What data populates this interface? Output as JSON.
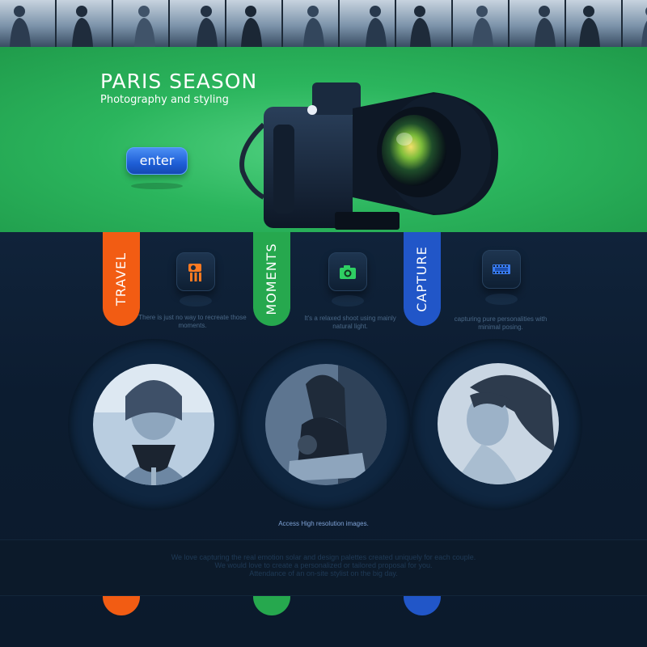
{
  "thumbnails": [
    {
      "name": "thumb-1"
    },
    {
      "name": "thumb-2"
    },
    {
      "name": "thumb-3"
    },
    {
      "name": "thumb-4"
    },
    {
      "name": "thumb-5"
    },
    {
      "name": "thumb-6"
    },
    {
      "name": "thumb-7"
    },
    {
      "name": "thumb-8"
    },
    {
      "name": "thumb-9"
    },
    {
      "name": "thumb-10"
    },
    {
      "name": "thumb-11"
    },
    {
      "name": "thumb-12"
    }
  ],
  "hero": {
    "title": "PARIS SEASON",
    "subtitle": "Photography and styling",
    "enter_label": "enter",
    "background_color": "#2bb55d"
  },
  "features": [
    {
      "label": "TRAVEL",
      "color": "#f25c13",
      "icon": "camera-tripod-icon",
      "icon_color": "#ff7a22",
      "text": "There is just no way to recreate those moments."
    },
    {
      "label": "MOMENTS",
      "color": "#26a84e",
      "icon": "camera-icon",
      "icon_color": "#2fcf63",
      "text": "It's a relaxed shoot using mainly natural light."
    },
    {
      "label": "CAPTURE",
      "color": "#2156c8",
      "icon": "film-strip-icon",
      "icon_color": "#3a7cf0",
      "text": "capturing pure personalities with minimal posing."
    }
  ],
  "access_text": "Access High resolution images.",
  "band_lines": [
    "We love capturing the real emotion solar and design palettes created uniquely for each couple.",
    "We would love to create a personalized or tailored proposal for you.",
    "Attendance of an on-site stylist on the big day."
  ]
}
